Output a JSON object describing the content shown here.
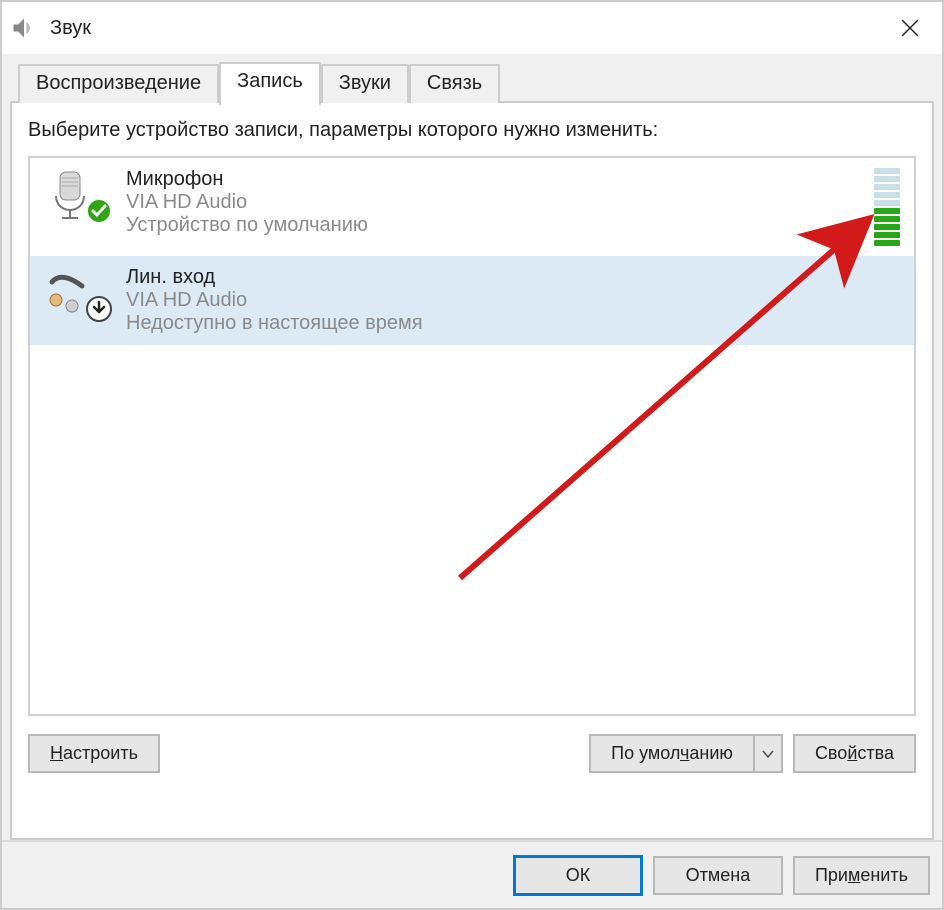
{
  "window": {
    "title": "Звук"
  },
  "tabs": {
    "playback": "Воспроизведение",
    "recording": "Запись",
    "sounds": "Звуки",
    "communications": "Связь"
  },
  "instruction": "Выберите устройство записи, параметры которого нужно изменить:",
  "devices": [
    {
      "name": "Микрофон",
      "driver": "VIA HD Audio",
      "status": "Устройство по умолчанию"
    },
    {
      "name": "Лин. вход",
      "driver": "VIA HD Audio",
      "status": "Недоступно в настоящее время"
    }
  ],
  "buttons": {
    "configure_pre": "Н",
    "configure_post": "астроить",
    "set_default_pre": "По умол",
    "set_default_ul": "ч",
    "set_default_post": "анию",
    "properties_pre": "Сво",
    "properties_ul": "й",
    "properties_post": "ства",
    "ok": "ОК",
    "cancel": "Отмена",
    "apply_pre": "При",
    "apply_ul": "м",
    "apply_post": "енить"
  }
}
